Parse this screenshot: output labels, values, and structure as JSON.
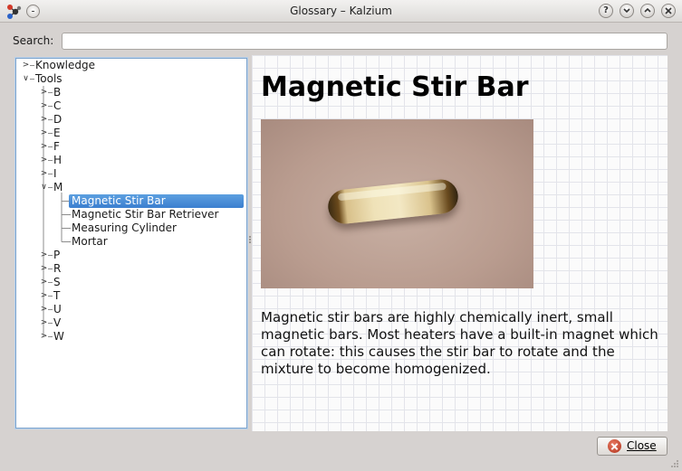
{
  "window": {
    "title": "Glossary – Kalzium"
  },
  "search": {
    "label": "Search:",
    "value": ""
  },
  "tree": {
    "rows": [
      {
        "label": "Knowledge",
        "level": 0,
        "state": "collapsed"
      },
      {
        "label": "Tools",
        "level": 0,
        "state": "expanded"
      },
      {
        "label": "B",
        "level": 1,
        "state": "collapsed"
      },
      {
        "label": "C",
        "level": 1,
        "state": "collapsed"
      },
      {
        "label": "D",
        "level": 1,
        "state": "collapsed"
      },
      {
        "label": "E",
        "level": 1,
        "state": "collapsed"
      },
      {
        "label": "F",
        "level": 1,
        "state": "collapsed"
      },
      {
        "label": "H",
        "level": 1,
        "state": "collapsed"
      },
      {
        "label": "I",
        "level": 1,
        "state": "collapsed"
      },
      {
        "label": "M",
        "level": 1,
        "state": "expanded"
      },
      {
        "label": "Magnetic Stir Bar",
        "level": 2,
        "state": "leaf",
        "selected": true
      },
      {
        "label": "Magnetic Stir Bar Retriever",
        "level": 2,
        "state": "leaf"
      },
      {
        "label": "Measuring Cylinder",
        "level": 2,
        "state": "leaf"
      },
      {
        "label": "Mortar",
        "level": 2,
        "state": "leaf"
      },
      {
        "label": "P",
        "level": 1,
        "state": "collapsed"
      },
      {
        "label": "R",
        "level": 1,
        "state": "collapsed"
      },
      {
        "label": "S",
        "level": 1,
        "state": "collapsed"
      },
      {
        "label": "T",
        "level": 1,
        "state": "collapsed"
      },
      {
        "label": "U",
        "level": 1,
        "state": "collapsed"
      },
      {
        "label": "V",
        "level": 1,
        "state": "collapsed"
      },
      {
        "label": "W",
        "level": 1,
        "state": "collapsed"
      }
    ]
  },
  "entry": {
    "title": "Magnetic Stir Bar",
    "description": "Magnetic stir bars are highly chemically inert, small magnetic bars. Most heaters have a built-in magnet which can rotate: this causes the stir bar to rotate and the mixture to become homogenized."
  },
  "buttons": {
    "close_label": "Close"
  },
  "colors": {
    "selection": "#3b7fcf",
    "close_icon": "#c0412a"
  }
}
